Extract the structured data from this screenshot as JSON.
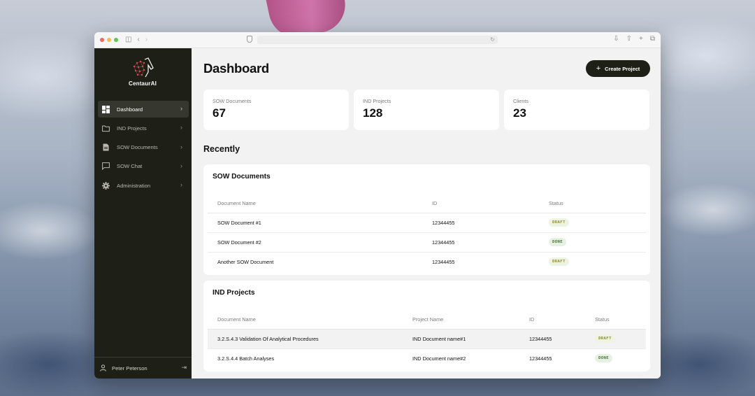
{
  "app": {
    "name": "CentaurAI"
  },
  "colors": {
    "sidebar_bg": "#1e1f17",
    "accent_dark": "#1e1f17",
    "draft_badge": "#8c8a3a",
    "done_badge": "#4f6f3e"
  },
  "sidebar": {
    "items": [
      {
        "label": "Dashboard",
        "icon": "dashboard-icon",
        "active": true
      },
      {
        "label": "IND Projects",
        "icon": "folder-icon"
      },
      {
        "label": "SOW Documents",
        "icon": "document-icon"
      },
      {
        "label": "SOW Chat",
        "icon": "chat-icon"
      },
      {
        "label": "Administration",
        "icon": "gear-icon"
      }
    ],
    "user": {
      "name": "Peter Peterson"
    }
  },
  "header": {
    "title": "Dashboard",
    "create_label": "Create Project"
  },
  "stats": [
    {
      "label": "SOW Documents",
      "value": "67"
    },
    {
      "label": "IND Projects",
      "value": "128"
    },
    {
      "label": "Clients",
      "value": "23"
    }
  ],
  "recent": {
    "title": "Recently",
    "sow": {
      "title": "SOW Documents",
      "columns": [
        "Document Name",
        "ID",
        "Status"
      ],
      "rows": [
        {
          "name": "SOW Document #1",
          "id": "12344455",
          "status": "DRAFT"
        },
        {
          "name": "SOW Document #2",
          "id": "12344455",
          "status": "DONE"
        },
        {
          "name": "Another SOW Document",
          "id": "12344455",
          "status": "DRAFT"
        }
      ]
    },
    "ind": {
      "title": "IND Projects",
      "columns": [
        "Document Name",
        "Project Name",
        "ID",
        "Status"
      ],
      "rows": [
        {
          "name": "3.2.S.4.3 Validation Of Analytical Procedures",
          "project": "IND Document name#1",
          "id": "12344455",
          "status": "DRAFT"
        },
        {
          "name": "3.2.S.4.4 Batch Analyses",
          "project": "IND Document name#2",
          "id": "12344455",
          "status": "DONE"
        }
      ]
    }
  }
}
